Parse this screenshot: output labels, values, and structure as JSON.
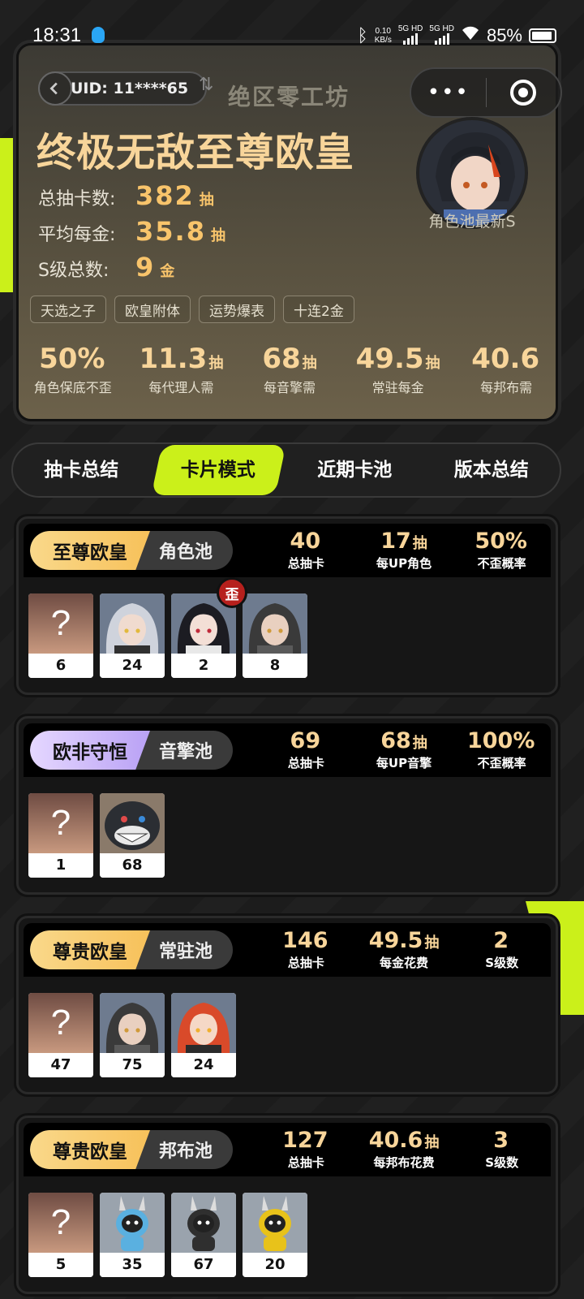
{
  "status_bar": {
    "time": "18:31",
    "net_speed_top": "0.10",
    "net_speed_bottom": "KB/s",
    "sim1": "5G HD",
    "sim2": "5G HD",
    "battery": "85%"
  },
  "header": {
    "uid": "UID: 11****65",
    "brand": "绝区零工坊",
    "rank_title": "终极无敌至尊欧皇",
    "avatar_caption": "角色池最新S",
    "stats": [
      {
        "label": "总抽卡数:",
        "value": "382",
        "unit": "抽"
      },
      {
        "label": "平均每金:",
        "value": "35.8",
        "unit": "抽"
      },
      {
        "label": "S级总数:",
        "value": "9",
        "unit": "金"
      }
    ],
    "tags": [
      "天选之子",
      "欧皇附体",
      "运势爆表",
      "十连2金"
    ],
    "metrics": [
      {
        "value": "50%",
        "unit": "",
        "label": "角色保底不歪"
      },
      {
        "value": "11.3",
        "unit": "抽",
        "label": "每代理人需"
      },
      {
        "value": "68",
        "unit": "抽",
        "label": "每音擎需"
      },
      {
        "value": "49.5",
        "unit": "抽",
        "label": "常驻每金"
      },
      {
        "value": "40.6",
        "unit": "",
        "label": "每邦布需"
      }
    ]
  },
  "tabs": [
    "抽卡总结",
    "卡片模式",
    "近期卡池",
    "版本总结"
  ],
  "active_tab": "卡片模式",
  "pools": [
    {
      "rank": "至尊欧皇",
      "rank_color": "gold",
      "name": "角色池",
      "stats": [
        {
          "value": "40",
          "unit": "",
          "label": "总抽卡"
        },
        {
          "value": "17",
          "unit": "抽",
          "label": "每UP角色"
        },
        {
          "value": "50%",
          "unit": "",
          "label": "不歪概率"
        }
      ],
      "cards": [
        {
          "type": "unknown",
          "mark": "?",
          "count": "6"
        },
        {
          "type": "agent",
          "count": "24"
        },
        {
          "type": "agent",
          "count": "2",
          "badge": "歪"
        },
        {
          "type": "agent",
          "count": "8"
        }
      ]
    },
    {
      "rank": "欧非守恒",
      "rank_color": "purple",
      "name": "音擎池",
      "stats": [
        {
          "value": "69",
          "unit": "",
          "label": "总抽卡"
        },
        {
          "value": "68",
          "unit": "抽",
          "label": "每UP音擎"
        },
        {
          "value": "100%",
          "unit": "",
          "label": "不歪概率"
        }
      ],
      "cards": [
        {
          "type": "unknown",
          "mark": "?",
          "count": "1"
        },
        {
          "type": "engine",
          "count": "68"
        }
      ]
    },
    {
      "rank": "尊贵欧皇",
      "rank_color": "gold",
      "name": "常驻池",
      "stats": [
        {
          "value": "146",
          "unit": "",
          "label": "总抽卡"
        },
        {
          "value": "49.5",
          "unit": "抽",
          "label": "每金花费"
        },
        {
          "value": "2",
          "unit": "",
          "label": "S级数"
        }
      ],
      "cards": [
        {
          "type": "unknown",
          "mark": "?",
          "count": "47"
        },
        {
          "type": "agent",
          "count": "75"
        },
        {
          "type": "agent",
          "count": "24"
        }
      ]
    },
    {
      "rank": "尊贵欧皇",
      "rank_color": "gold",
      "name": "邦布池",
      "stats": [
        {
          "value": "127",
          "unit": "",
          "label": "总抽卡"
        },
        {
          "value": "40.6",
          "unit": "抽",
          "label": "每邦布花费"
        },
        {
          "value": "3",
          "unit": "",
          "label": "S级数"
        }
      ],
      "cards": [
        {
          "type": "unknown",
          "mark": "?",
          "count": "5"
        },
        {
          "type": "bangboo",
          "count": "35"
        },
        {
          "type": "bangboo",
          "count": "67"
        },
        {
          "type": "bangboo",
          "count": "20"
        }
      ]
    }
  ],
  "colors": {
    "accent": "#cbf01a",
    "gold": "#f8d59a",
    "card_bg": "#161616"
  }
}
